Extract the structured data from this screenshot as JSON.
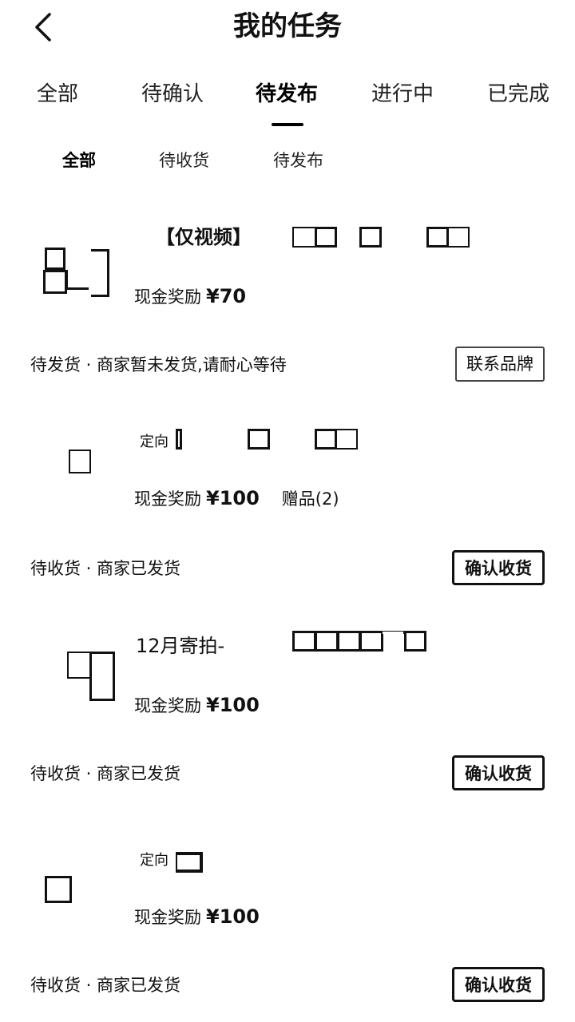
{
  "header": {
    "title": "我的任务",
    "back_icon": "chevron-left-icon"
  },
  "tabs": [
    {
      "label": "全部",
      "active": false
    },
    {
      "label": "待确认",
      "active": false
    },
    {
      "label": "待发布",
      "active": true
    },
    {
      "label": "进行中",
      "active": false
    },
    {
      "label": "已完成",
      "active": false
    }
  ],
  "subtabs": [
    {
      "label": "全部",
      "active": true
    },
    {
      "label": "待收货",
      "active": false
    },
    {
      "label": "待发布",
      "active": false
    }
  ],
  "tasks": [
    {
      "title": "【仅视频】",
      "reward_label": "现金奖励",
      "reward_amount": "¥70",
      "gift": "",
      "status": "待发货 · 商家暂未发货,请耐心等待",
      "button": "联系品牌"
    },
    {
      "title": "定向",
      "reward_label": "现金奖励",
      "reward_amount": "¥100",
      "gift": "赠品(2)",
      "status": "待收货 · 商家已发货",
      "button": "确认收货"
    },
    {
      "title": "12月寄拍-",
      "reward_label": "现金奖励",
      "reward_amount": "¥100",
      "gift": "",
      "status": "待收货 · 商家已发货",
      "button": "确认收货"
    },
    {
      "title": "定向",
      "reward_label": "现金奖励",
      "reward_amount": "¥100",
      "gift": "",
      "status": "待收货 · 商家已发货",
      "button": "确认收货"
    }
  ]
}
